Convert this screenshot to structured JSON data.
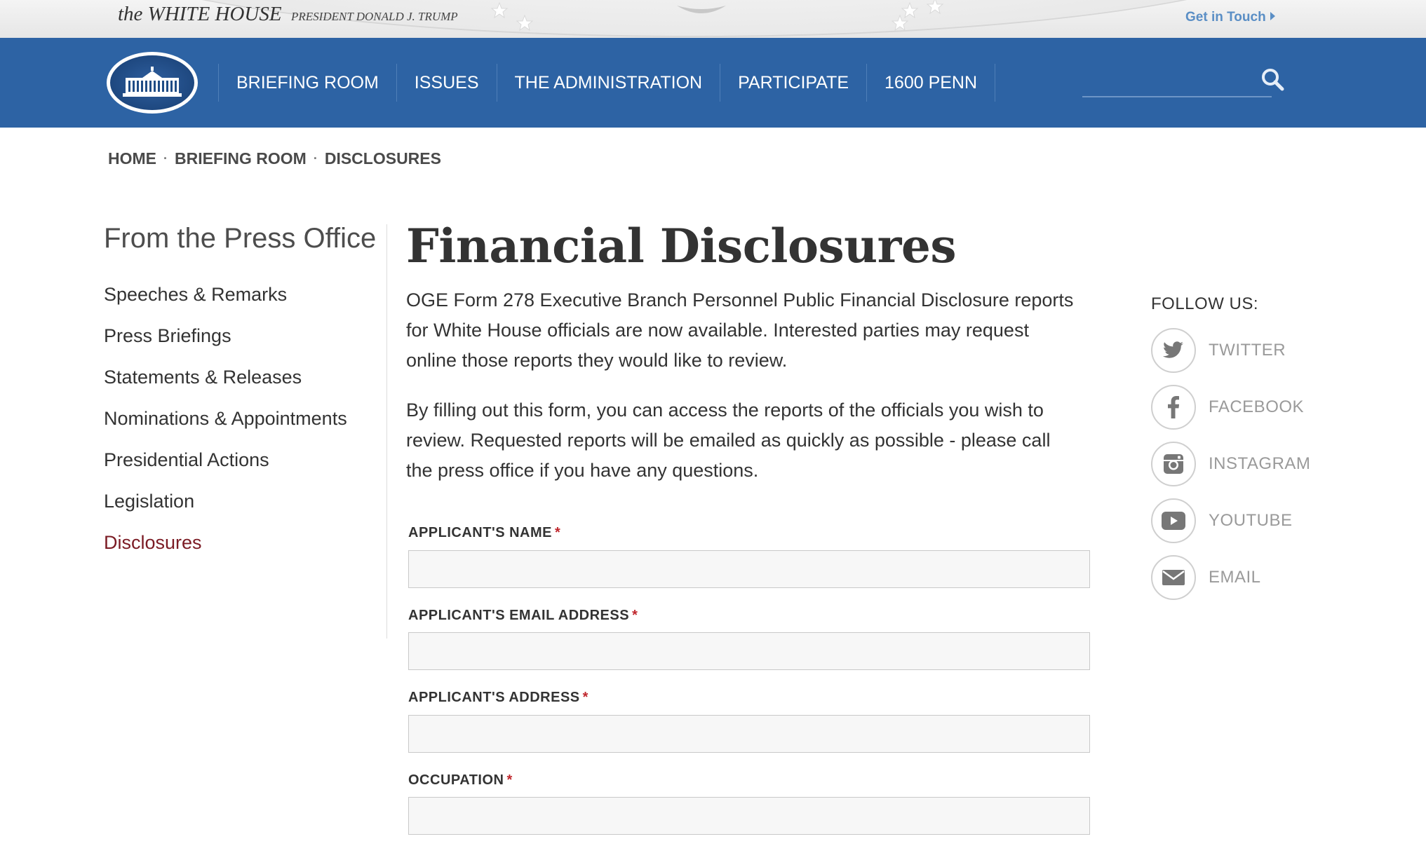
{
  "header": {
    "brand": "the WHITE HOUSE",
    "subtitle": "PRESIDENT DONALD J. TRUMP",
    "get_in_touch": "Get in Touch"
  },
  "nav": {
    "items": [
      {
        "label": "BRIEFING ROOM"
      },
      {
        "label": "ISSUES"
      },
      {
        "label": "THE ADMINISTRATION"
      },
      {
        "label": "PARTICIPATE"
      },
      {
        "label": "1600 PENN"
      }
    ],
    "search": {
      "placeholder": ""
    }
  },
  "breadcrumb": [
    "HOME",
    "BRIEFING ROOM",
    "DISCLOSURES"
  ],
  "sidebar": {
    "title": "From the Press Office",
    "items": [
      {
        "label": "Speeches & Remarks"
      },
      {
        "label": "Press Briefings"
      },
      {
        "label": "Statements & Releases"
      },
      {
        "label": "Nominations & Appointments"
      },
      {
        "label": "Presidential Actions"
      },
      {
        "label": "Legislation"
      },
      {
        "label": "Disclosures"
      }
    ]
  },
  "main": {
    "title": "Financial Disclosures",
    "paragraphs": [
      "OGE Form 278 Executive Branch Personnel Public Financial Disclosure reports for White House officials are now available.  Interested parties may request online those reports they would like to review.",
      "By filling out this form, you can access the reports of the officials you wish to review.  Requested reports will be emailed as quickly as possible - please call the press office if you have any questions."
    ],
    "fields": [
      {
        "label": "APPLICANT'S NAME",
        "required": "*",
        "value": ""
      },
      {
        "label": "APPLICANT'S EMAIL ADDRESS",
        "required": "*",
        "value": ""
      },
      {
        "label": "APPLICANT'S ADDRESS",
        "required": "*",
        "value": ""
      },
      {
        "label": "OCCUPATION",
        "required": "*",
        "value": ""
      }
    ]
  },
  "follow": {
    "title": "FOLLOW US:",
    "items": [
      {
        "label": "TWITTER",
        "icon": "twitter-icon"
      },
      {
        "label": "FACEBOOK",
        "icon": "facebook-icon"
      },
      {
        "label": "INSTAGRAM",
        "icon": "instagram-icon"
      },
      {
        "label": "YOUTUBE",
        "icon": "youtube-icon"
      },
      {
        "label": "EMAIL",
        "icon": "email-icon"
      }
    ]
  },
  "colors": {
    "nav_blue": "#2d63a4",
    "link_blue": "#5a8ec5",
    "active_red": "#7b1b24",
    "required_red": "#c0272d"
  }
}
